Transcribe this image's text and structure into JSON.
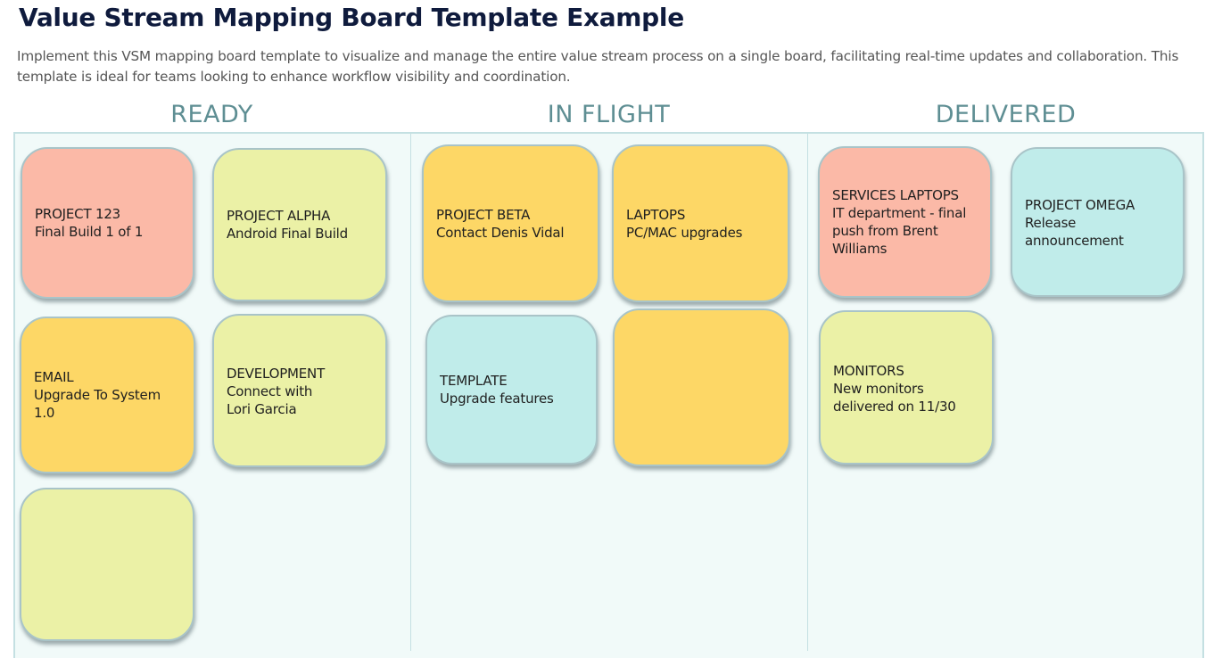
{
  "header": {
    "title": "Value Stream Mapping Board Template Example",
    "description": "Implement this VSM mapping board template to visualize and manage the entire value stream process on a single board, facilitating real-time updates and collaboration. This template is ideal for teams looking to enhance workflow visibility and coordination."
  },
  "colors": {
    "salmon": "#fbb9a7",
    "lime": "#ebf1a6",
    "orange": "#fdd766",
    "cyan": "#c0ecea",
    "board_bg": "#f1faf9",
    "header_text": "#5e8e93"
  },
  "columns": [
    {
      "label": "READY",
      "cards": [
        {
          "title": "PROJECT 123",
          "body": "Final Build 1 of 1",
          "color": "#fbb9a7"
        },
        {
          "title": "PROJECT ALPHA",
          "body": "Android Final Build",
          "color": "#ebf1a6"
        },
        {
          "title": "EMAIL",
          "body": "Upgrade To System\n1.0",
          "color": "#fdd766"
        },
        {
          "title": "DEVELOPMENT",
          "body": "Connect with\nLori Garcia",
          "color": "#ebf1a6"
        },
        {
          "title": "",
          "body": "",
          "color": "#ebf1a6"
        }
      ]
    },
    {
      "label": "IN FLIGHT",
      "cards": [
        {
          "title": "PROJECT BETA",
          "body": "Contact Denis Vidal",
          "color": "#fdd766"
        },
        {
          "title": "LAPTOPS",
          "body": "PC/MAC upgrades",
          "color": "#fdd766"
        },
        {
          "title": "TEMPLATE",
          "body": "Upgrade features",
          "color": "#c0ecea"
        },
        {
          "title": "",
          "body": "",
          "color": "#fdd766"
        }
      ]
    },
    {
      "label": "DELIVERED",
      "cards": [
        {
          "title": "SERVICES LAPTOPS",
          "body": "IT department - final\npush from Brent\nWilliams",
          "color": "#fbb9a7"
        },
        {
          "title": "PROJECT OMEGA",
          "body": "Release\nannouncement",
          "color": "#c0ecea"
        },
        {
          "title": "MONITORS",
          "body": "New monitors\ndelivered on 11/30",
          "color": "#ebf1a6"
        }
      ]
    }
  ]
}
